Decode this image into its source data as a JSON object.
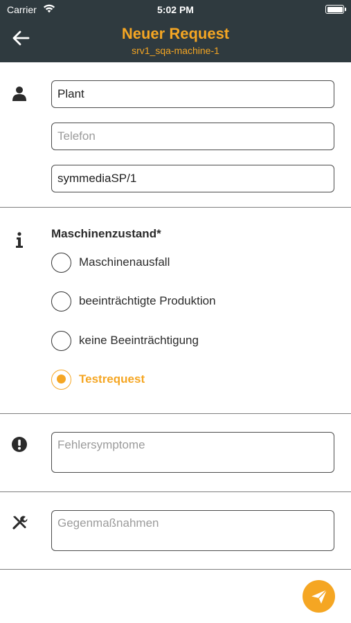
{
  "status_bar": {
    "carrier": "Carrier",
    "time": "5:02 PM"
  },
  "header": {
    "title": "Neuer Request",
    "subtitle": "srv1_sqa-machine-1",
    "back_icon": "arrow-left-icon"
  },
  "contact": {
    "icon": "person-icon",
    "name_value": "Plant",
    "phone_placeholder": "Telefon",
    "location_value": "symmediaSP/1"
  },
  "machine_state": {
    "icon": "info-icon",
    "label": "Maschinenzustand*",
    "options": [
      {
        "label": "Maschinenausfall",
        "selected": false
      },
      {
        "label": "beeinträchtigte Produktion",
        "selected": false
      },
      {
        "label": "keine Beeinträchtigung",
        "selected": false
      },
      {
        "label": "Testrequest",
        "selected": true
      }
    ]
  },
  "symptoms": {
    "icon": "exclamation-circle-icon",
    "placeholder": "Fehlersymptome"
  },
  "countermeasures": {
    "icon": "tools-icon",
    "placeholder": "Gegenmaßnahmen"
  },
  "send": {
    "icon": "paper-plane-icon"
  },
  "colors": {
    "header_bg": "#2f3a3f",
    "accent": "#f5a623",
    "text": "#2b2b2b",
    "placeholder": "#9b9b9b"
  }
}
